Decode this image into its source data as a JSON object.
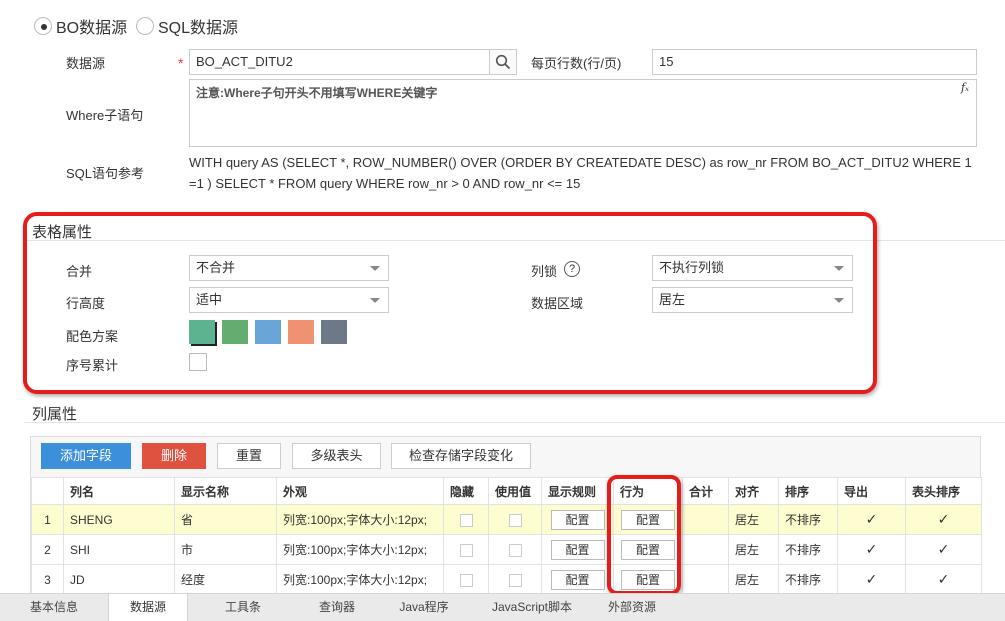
{
  "datasource_type": {
    "options": [
      "BO数据源",
      "SQL数据源"
    ],
    "selected": "BO数据源"
  },
  "form": {
    "datasource_label": "数据源",
    "required_mark": "*",
    "datasource_value": "BO_ACT_DITU2",
    "rows_per_page_label": "每页行数(行/页)",
    "rows_per_page_value": "15",
    "where_label": "Where子语句",
    "where_placeholder": "注意:Where子句开头不用填写WHERE关键字",
    "fx_label": "fₓ",
    "sql_label": "SQL语句参考",
    "sql_text": "WITH query AS (SELECT *, ROW_NUMBER() OVER (ORDER BY CREATEDATE DESC) as row_nr FROM BO_ACT_DITU2 WHERE 1 =1 ) SELECT * FROM query WHERE row_nr > 0 AND row_nr <= 15"
  },
  "table_props": {
    "title": "表格属性",
    "merge_label": "合并",
    "merge_value": "不合并",
    "lock_label": "列锁",
    "lock_help": "?",
    "lock_value": "不执行列锁",
    "row_height_label": "行高度",
    "row_height_value": "适中",
    "data_area_label": "数据区域",
    "data_area_value": "居左",
    "color_scheme_label": "配色方案",
    "color_scheme": [
      "#5bb38f",
      "#62ad6f",
      "#6aa5d8",
      "#ee9272",
      "#6d7888"
    ],
    "serial_label": "序号累计"
  },
  "col_props": {
    "title": "列属性",
    "toolbar": [
      "添加字段",
      "删除",
      "重置",
      "多级表头",
      "检查存储字段变化"
    ],
    "columns": [
      "",
      "列名",
      "显示名称",
      "外观",
      "隐藏",
      "使用值",
      "显示规则",
      "行为",
      "合计",
      "对齐",
      "排序",
      "导出",
      "表头排序"
    ],
    "rows": [
      {
        "idx": "1",
        "name": "SHENG",
        "display": "省",
        "look": "列宽:100px;字体大小:12px;",
        "rule": "配置",
        "action": "配置",
        "align": "居左",
        "sort": "不排序"
      },
      {
        "idx": "2",
        "name": "SHI",
        "display": "市",
        "look": "列宽:100px;字体大小:12px;",
        "rule": "配置",
        "action": "配置",
        "align": "居左",
        "sort": "不排序"
      },
      {
        "idx": "3",
        "name": "JD",
        "display": "经度",
        "look": "列宽:100px;字体大小:12px;",
        "rule": "配置",
        "action": "配置",
        "align": "居左",
        "sort": "不排序"
      }
    ],
    "check_mark": "✓"
  },
  "bottom_tabs": [
    "基本信息",
    "数据源",
    "工具条",
    "查询器",
    "Java程序",
    "JavaScript脚本",
    "外部资源"
  ],
  "active_tab": "数据源",
  "colors": {
    "highlight_red": "#e51c1c",
    "primary_blue": "#3b8fdb",
    "danger_red": "#df5240"
  }
}
